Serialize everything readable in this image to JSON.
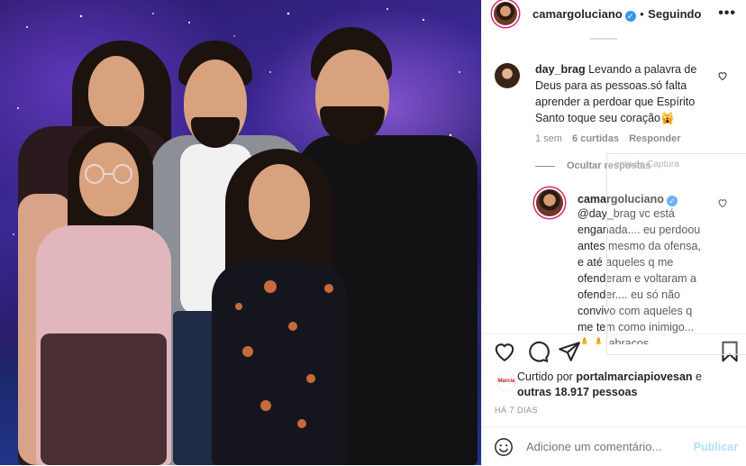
{
  "post": {
    "username": "camargoluciano",
    "verified": true,
    "separator": "•",
    "follow_state": "Seguindo",
    "more_options": "•••"
  },
  "comments": [
    {
      "username": "day_brag",
      "text": "Levando a palavra de Deus para as pessoas.só falta aprender a perdoar que Espírito Santo toque seu coração🙀",
      "age": "1 sem",
      "likes": "6 curtidas",
      "reply_label": "Responder",
      "hide_replies": "Ocultar respostas"
    }
  ],
  "reply": {
    "username": "camargoluciano",
    "verified": true,
    "lines": [
      "@day_brag vc está",
      "enganada.... eu perdoou",
      "antes mesmo da ofensa,",
      "e até aqueles q me",
      "ofenderam e voltaram a",
      "ofender.... eu só não",
      "convivo com aqueles q",
      "me tem como inimigo...",
      "🙏🙏 abraços"
    ]
  },
  "overlay": {
    "label": "enta de Captura"
  },
  "likes": {
    "prefix": "Curtido por",
    "liked_by": "portalmarciapiovesan",
    "conjunction": "e",
    "others": "outras 18.917 pessoas",
    "liker_avatar_text": "Marcia"
  },
  "timestamp": "HÁ 7 DIAS",
  "add_comment": {
    "placeholder": "Adicione um comentário...",
    "publish_label": "Publicar"
  },
  "icons": {
    "like": "heart-icon",
    "comment": "comment-icon",
    "share": "send-icon",
    "save": "bookmark-icon",
    "emoji": "smiley-icon"
  },
  "colors": {
    "verified": "#3897f0",
    "story_ring": "#d62976",
    "publish_disabled": "#b2dffc",
    "muted": "#8e8e8e"
  }
}
